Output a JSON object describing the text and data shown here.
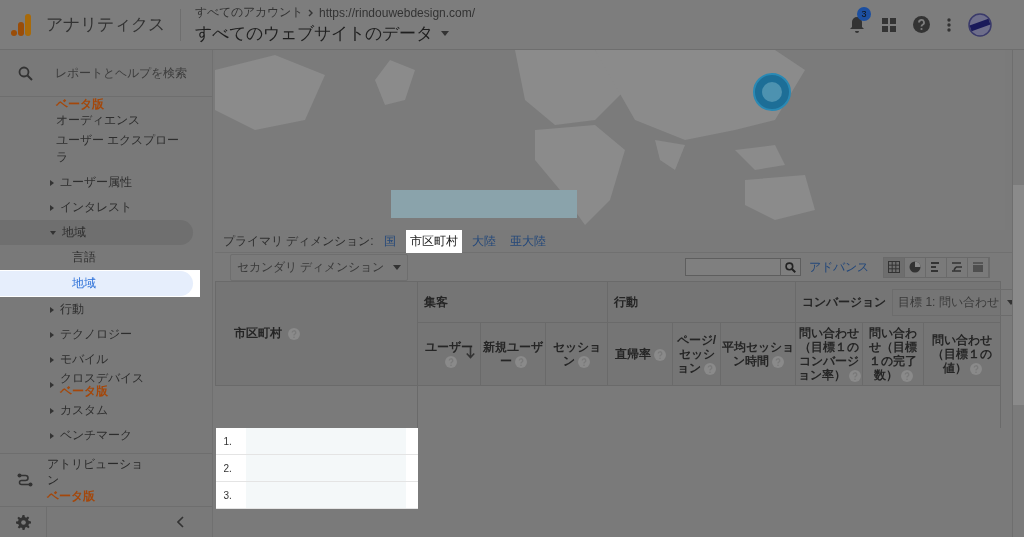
{
  "header": {
    "product": "アナリティクス",
    "breadcrumb": "すべてのアカウント",
    "url": "https://rindouwebdesign.com/",
    "view": "すべてのウェブサイトのデータ",
    "notification_count": "3"
  },
  "sidebar": {
    "search_placeholder": "レポートとヘルプを検索",
    "top_badge": "ベータ版",
    "items": [
      {
        "label": "オーディエンス",
        "kind": "link"
      },
      {
        "label": "ユーザー エクスプローラ",
        "kind": "link"
      },
      {
        "label": "ユーザー属性",
        "kind": "group",
        "expanded": false
      },
      {
        "label": "インタレスト",
        "kind": "group",
        "expanded": false
      },
      {
        "label": "地域",
        "kind": "group",
        "expanded": true,
        "children": [
          {
            "label": "言語",
            "selected": false
          },
          {
            "label": "地域",
            "selected": true
          }
        ]
      },
      {
        "label": "行動",
        "kind": "group",
        "expanded": false
      },
      {
        "label": "テクノロジー",
        "kind": "group",
        "expanded": false
      },
      {
        "label": "モバイル",
        "kind": "group",
        "expanded": false
      },
      {
        "label": "クロスデバイス",
        "kind": "group",
        "expanded": false,
        "badge": "ベータ版"
      },
      {
        "label": "カスタム",
        "kind": "group",
        "expanded": false
      },
      {
        "label": "ベンチマーク",
        "kind": "group",
        "expanded": false
      }
    ],
    "attribution": {
      "label": "アトリビューション",
      "badge": "ベータ版"
    }
  },
  "primary_dimension": {
    "label": "プライマリ ディメンション:",
    "options": [
      {
        "label": "国",
        "selected": false
      },
      {
        "label": "市区町村",
        "selected": true
      },
      {
        "label": "大陸",
        "selected": false
      },
      {
        "label": "亜大陸",
        "selected": false
      }
    ]
  },
  "toolbar": {
    "secondary_dimension": "セカンダリ ディメンション",
    "advanced_link": "アドバンス",
    "view_modes": [
      {
        "kind": "table",
        "selected": true
      },
      {
        "kind": "pie",
        "selected": false
      },
      {
        "kind": "bars",
        "selected": false
      },
      {
        "kind": "compare",
        "selected": false
      },
      {
        "kind": "pivot",
        "selected": false
      }
    ]
  },
  "table": {
    "dimension": "市区町村",
    "groups": [
      {
        "label": "集客",
        "columns": [
          {
            "label": "ユーザー",
            "sorted": true
          },
          {
            "label": "新規ユーザー",
            "sorted": false
          },
          {
            "label": "セッション",
            "sorted": false
          }
        ]
      },
      {
        "label": "行動",
        "columns": [
          {
            "label": "直帰率",
            "sorted": false
          },
          {
            "label": "ページ/セッション",
            "sorted": false
          },
          {
            "label": "平均セッション時間",
            "sorted": false
          }
        ]
      },
      {
        "label": "コンバージョン",
        "goal_select": "目標 1: 問い合わせ",
        "columns": [
          {
            "label": "問い合わせ（目標１のコンバージョン率）",
            "sorted": false
          },
          {
            "label": "問い合わせ（目標１の完了数）",
            "sorted": false
          },
          {
            "label": "問い合わせ（目標１の値）",
            "sorted": false
          }
        ]
      }
    ],
    "rows": [
      {
        "rank": "1."
      },
      {
        "rank": "2."
      },
      {
        "rank": "3."
      }
    ]
  }
}
